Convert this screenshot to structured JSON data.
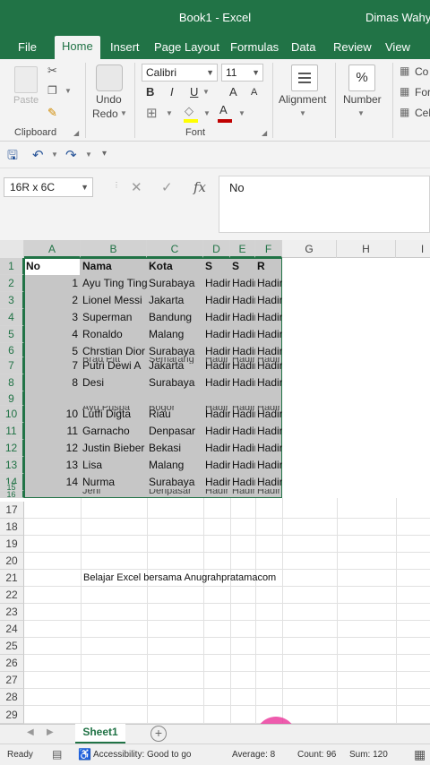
{
  "window": {
    "title": "Book1  -  Excel",
    "user": "Dimas Wahyu"
  },
  "ribbon_tabs": [
    {
      "label": "File",
      "active": false
    },
    {
      "label": "Home",
      "active": true
    },
    {
      "label": "Insert",
      "active": false
    },
    {
      "label": "Page Layout",
      "active": false
    },
    {
      "label": "Formulas",
      "active": false
    },
    {
      "label": "Data",
      "active": false
    },
    {
      "label": "Review",
      "active": false
    },
    {
      "label": "View",
      "active": false
    }
  ],
  "ribbon": {
    "paste_label": "Paste",
    "clipboard_group": "Clipboard",
    "undo_label": "Undo",
    "redo_label": "Redo",
    "font_name": "Calibri",
    "font_size": "11",
    "font_group": "Font",
    "bold": "B",
    "italic": "I",
    "underline": "U",
    "grow_font": "A",
    "shrink_font": "A",
    "font_color_letter": "A",
    "alignment_label": "Alignment",
    "number_label": "Number",
    "number_icon": "%",
    "styles_items": [
      "Co",
      "For",
      "Cel"
    ],
    "accent_color": "#217346",
    "highlight_color": "#ffff00",
    "font_color": "#c00000"
  },
  "quick_access": {
    "icons": [
      "save-icon",
      "undo-icon",
      "redo-icon",
      "customize-icon"
    ]
  },
  "formula_bar": {
    "name_box": "16R x 6C",
    "fx": "fx",
    "value": "No"
  },
  "grid": {
    "columns": [
      "A",
      "B",
      "C",
      "D",
      "E",
      "F",
      "G",
      "H",
      "I"
    ],
    "rows": [
      "1",
      "2",
      "3",
      "4",
      "5",
      "6",
      "7",
      "8",
      "9",
      "10",
      "11",
      "12",
      "13",
      "14",
      "15",
      "16",
      "17",
      "18",
      "19",
      "20",
      "21",
      "22",
      "23",
      "24",
      "25",
      "26",
      "27",
      "28",
      "29"
    ],
    "header": [
      "No",
      "Nama",
      "Kota",
      "S",
      "S",
      "R"
    ],
    "data_rows": [
      [
        "1",
        "Ayu Ting Ting",
        "Surabaya",
        "Hadir",
        "Hadir",
        "Hadir"
      ],
      [
        "2",
        "Lionel Messi",
        "Jakarta",
        "Hadir",
        "Hadir",
        "Hadir"
      ],
      [
        "3",
        "Superman",
        "Bandung",
        "Hadir",
        "Hadir",
        "Hadir"
      ],
      [
        "4",
        "Ronaldo",
        "Malang",
        "Hadir",
        "Hadir",
        "Hadir"
      ],
      [
        "5",
        "Chrstian Dior",
        "Surabaya",
        "Hadir",
        "Hadir",
        "Hadir"
      ],
      [
        "7",
        "Putri Dewi A",
        "Jakarta",
        "Hadir",
        "Hadir",
        "Hadir"
      ],
      [
        "8",
        "Desi",
        "Surabaya",
        "Hadir",
        "Hadir",
        "Hadir"
      ],
      [
        "10",
        "Lutfi Digta",
        "Riau",
        "Hadir",
        "Hadir",
        "Hadir"
      ],
      [
        "11",
        "Garnacho",
        "Denpasar",
        "Hadir",
        "Hadir",
        "Hadir"
      ],
      [
        "12",
        "Justin Bieber",
        "Bekasi",
        "Hadir",
        "Hadir",
        "Hadir"
      ],
      [
        "13",
        "Lisa",
        "Malang",
        "Hadir",
        "Hadir",
        "Hadir"
      ],
      [
        "14",
        "Nurma",
        "Surabaya",
        "Hadir",
        "Hadir",
        "Hadir"
      ]
    ],
    "hidden_rows": [
      [
        "Brad Pitt",
        "Semarang",
        "Hadir",
        "Hadir",
        "Hadir"
      ],
      [
        "Ayu Puspa",
        "Bogor",
        "Hadir",
        "Hadir",
        "Hadir"
      ],
      [
        "Jeni",
        "Denpasar",
        "Hadir",
        "Hadir",
        "Hadir"
      ]
    ],
    "note": "Belajar Excel bersama Anugrahpratamacom"
  },
  "sheet_tabs": {
    "active": "Sheet1",
    "add": "+"
  },
  "status_bar": {
    "ready": "Ready",
    "accessibility": "Accessibility: Good to go",
    "average": "Average: 8",
    "count": "Count: 96",
    "sum": "Sum: 120"
  }
}
